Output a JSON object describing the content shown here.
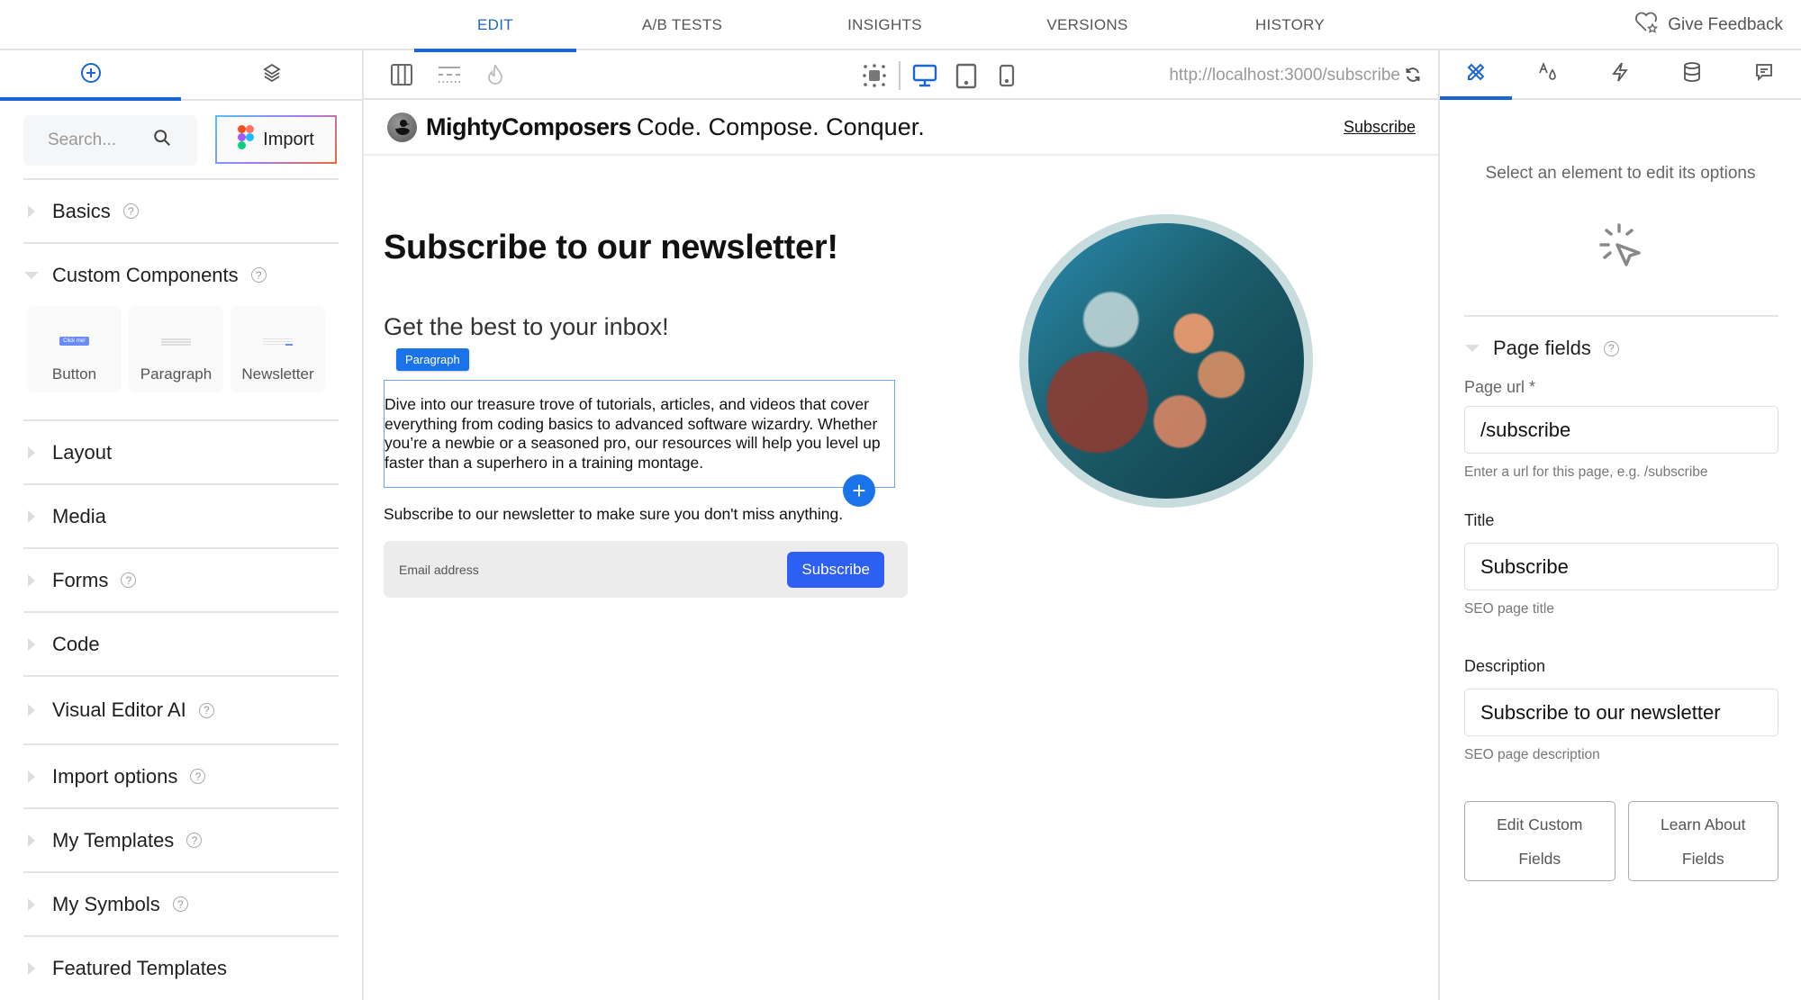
{
  "top_nav": {
    "tabs": [
      {
        "label": "EDIT",
        "active": true
      },
      {
        "label": "A/B TESTS",
        "active": false
      },
      {
        "label": "INSIGHTS",
        "active": false
      },
      {
        "label": "VERSIONS",
        "active": false
      },
      {
        "label": "HISTORY",
        "active": false
      }
    ],
    "feedback_label": "Give Feedback",
    "accent_color": "#1a66d2"
  },
  "left_panel": {
    "tabs": [
      {
        "icon": "add-circle-icon",
        "active": true
      },
      {
        "icon": "layers-icon",
        "active": false
      }
    ],
    "search_placeholder": "Search...",
    "import_label": "Import",
    "sections": {
      "basics": {
        "label": "Basics",
        "help": true,
        "expanded": false
      },
      "custom_components": {
        "label": "Custom Components",
        "help": true,
        "expanded": true,
        "items": [
          {
            "label": "Button",
            "thumb_text": "Click me!"
          },
          {
            "label": "Paragraph"
          },
          {
            "label": "Newsletter"
          }
        ]
      },
      "collapsed": [
        {
          "label": "Layout",
          "help": false
        },
        {
          "label": "Media",
          "help": false
        },
        {
          "label": "Forms",
          "help": true
        },
        {
          "label": "Code",
          "help": false
        },
        {
          "label": "Visual Editor AI",
          "help": true
        },
        {
          "label": "Import options",
          "help": true
        },
        {
          "label": "My Templates",
          "help": true
        },
        {
          "label": "My Symbols",
          "help": true
        },
        {
          "label": "Featured Templates",
          "help": false
        }
      ]
    }
  },
  "canvas_toolbar": {
    "left_icons": [
      "columns-icon",
      "spacing-icon",
      "flame-icon"
    ],
    "view_icons": [
      "select-region-icon",
      "desktop-icon",
      "tablet-icon",
      "mobile-icon"
    ],
    "active_view": "desktop",
    "url": "http://localhost:3000/subscribe"
  },
  "page": {
    "brand": "MightyComposers",
    "tagline": "Code. Compose. Conquer.",
    "header_link": "Subscribe",
    "heading": "Subscribe to our newsletter!",
    "subheading": "Get the best to your inbox!",
    "selected_badge": "Paragraph",
    "paragraph": "Dive into our treasure trove of tutorials, articles, and videos that cover everything from coding basics to advanced software wizardry. Whether you’re a newbie or a seasoned pro, our resources will help you level up faster than a superhero in a training montage.",
    "subtext": "Subscribe to our newsletter to make sure you don't miss anything.",
    "email_placeholder": "Email address",
    "subscribe_button": "Subscribe",
    "button_color": "#2d5ff2"
  },
  "right_panel": {
    "tabs": [
      {
        "icon": "design-tools-icon",
        "active": true
      },
      {
        "icon": "typography-icon",
        "active": false
      },
      {
        "icon": "lightning-icon",
        "active": false
      },
      {
        "icon": "database-icon",
        "active": false
      },
      {
        "icon": "comment-icon",
        "active": false
      }
    ],
    "hint": "Select an element to edit its options",
    "page_fields_label": "Page fields",
    "fields": {
      "page_url": {
        "label": "Page url *",
        "value": "/subscribe",
        "help": "Enter a url for this page, e.g. /subscribe"
      },
      "title": {
        "label": "Title",
        "value": "Subscribe",
        "help": "SEO page title"
      },
      "description": {
        "label": "Description",
        "value": "Subscribe to our newsletter",
        "help": "SEO page description"
      }
    },
    "buttons": {
      "edit_custom_fields": "Edit Custom Fields",
      "learn_about_fields": "Learn About Fields"
    }
  }
}
